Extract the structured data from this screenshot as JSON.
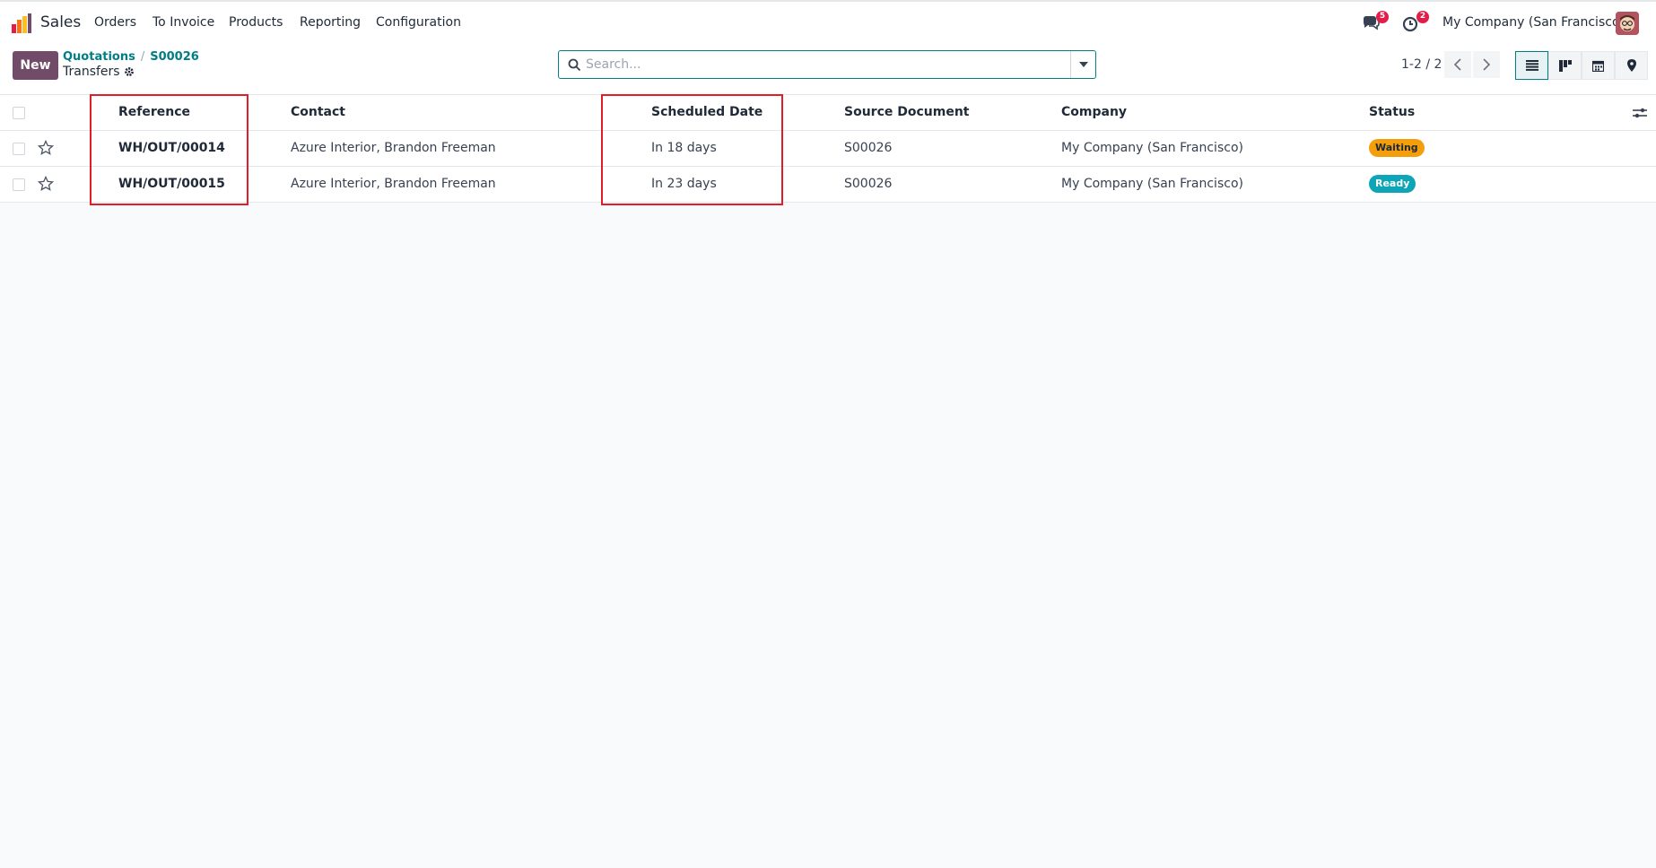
{
  "app": {
    "name": "Sales"
  },
  "menu": [
    "Orders",
    "To Invoice",
    "Products",
    "Reporting",
    "Configuration"
  ],
  "systray": {
    "messages_count": "5",
    "activities_count": "2",
    "company": "My Company (San Francisco)"
  },
  "control": {
    "new_label": "New",
    "breadcrumb": [
      "Quotations",
      "S00026"
    ],
    "current": "Transfers",
    "search_placeholder": "Search...",
    "pager": "1-2 / 2"
  },
  "table": {
    "headers": [
      "Reference",
      "Contact",
      "Scheduled Date",
      "Source Document",
      "Company",
      "Status"
    ],
    "rows": [
      {
        "reference": "WH/OUT/00014",
        "contact": "Azure Interior, Brandon Freeman",
        "scheduled": "In 18 days",
        "source": "S00026",
        "company": "My Company (San Francisco)",
        "status": "Waiting"
      },
      {
        "reference": "WH/OUT/00015",
        "contact": "Azure Interior, Brandon Freeman",
        "scheduled": "In 23 days",
        "source": "S00026",
        "company": "My Company (San Francisco)",
        "status": "Ready"
      }
    ]
  },
  "colors": {
    "brand": "#714B67",
    "link": "#017e84",
    "waiting": "#f59e0b",
    "ready": "#0ea5b7",
    "highlight": "#e11d2a"
  }
}
